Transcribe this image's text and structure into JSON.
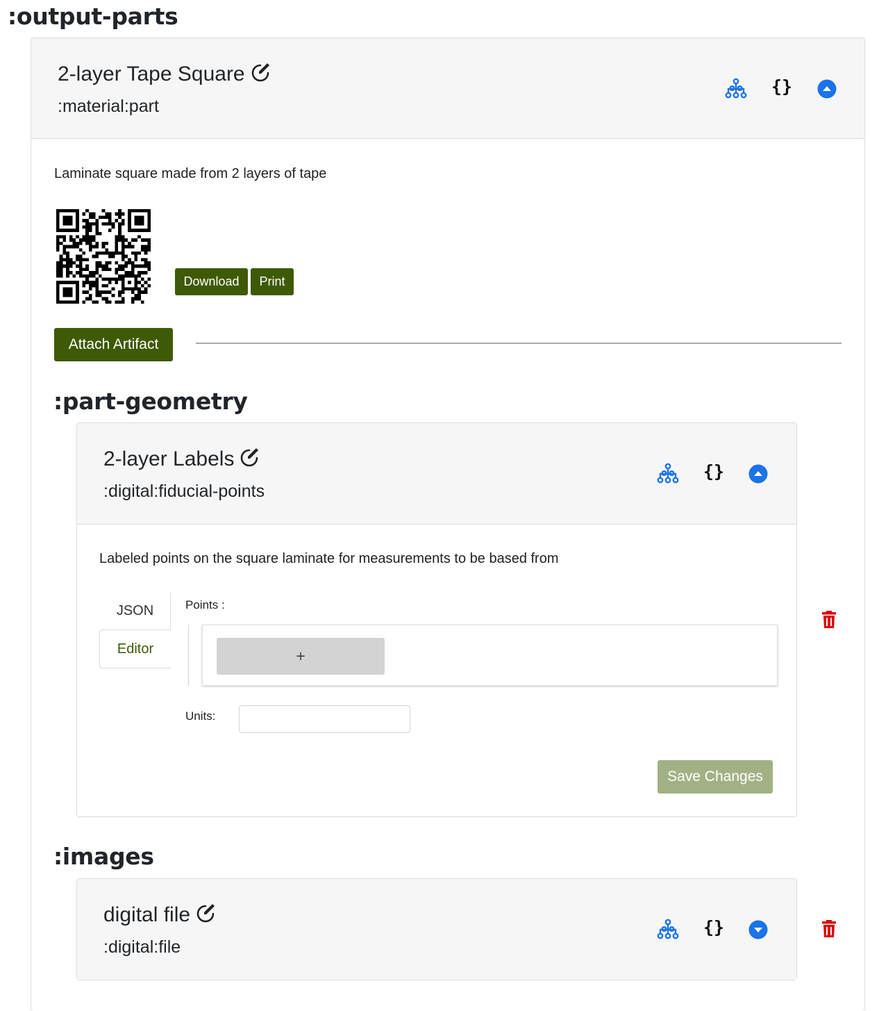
{
  "sections": {
    "output_parts": ":output-parts",
    "part_geometry": ":part-geometry",
    "images": ":images"
  },
  "part_card": {
    "title": "2-layer Tape Square",
    "type": ":material:part",
    "description": "Laminate square made from 2 layers of tape",
    "download_label": "Download",
    "print_label": "Print",
    "attach_label": "Attach Artifact"
  },
  "geometry_card": {
    "title": "2-layer Labels",
    "type": ":digital:fiducial-points",
    "description": "Labeled points on the square laminate for measurements to be based from",
    "tabs": [
      "JSON",
      "Editor"
    ],
    "active_tab": "Editor",
    "points_label": "Points :",
    "add_label": "+",
    "units_label": "Units:",
    "units_value": "",
    "save_label": "Save Changes"
  },
  "image_card": {
    "title": "digital file",
    "type": ":digital:file"
  },
  "icons": {
    "hierarchy": "hierarchy-icon",
    "json": "json-braces-icon",
    "collapse": "chevron-up-circle-icon",
    "expand": "chevron-down-circle-icon",
    "edit": "edit-pencil-icon",
    "delete": "trash-icon"
  },
  "colors": {
    "primary_blue": "#1a73e8",
    "button_green": "#3e5a06",
    "save_disabled": "#a2b184",
    "active_tab_text": "#3e5a06",
    "delete_red": "#e00000"
  }
}
